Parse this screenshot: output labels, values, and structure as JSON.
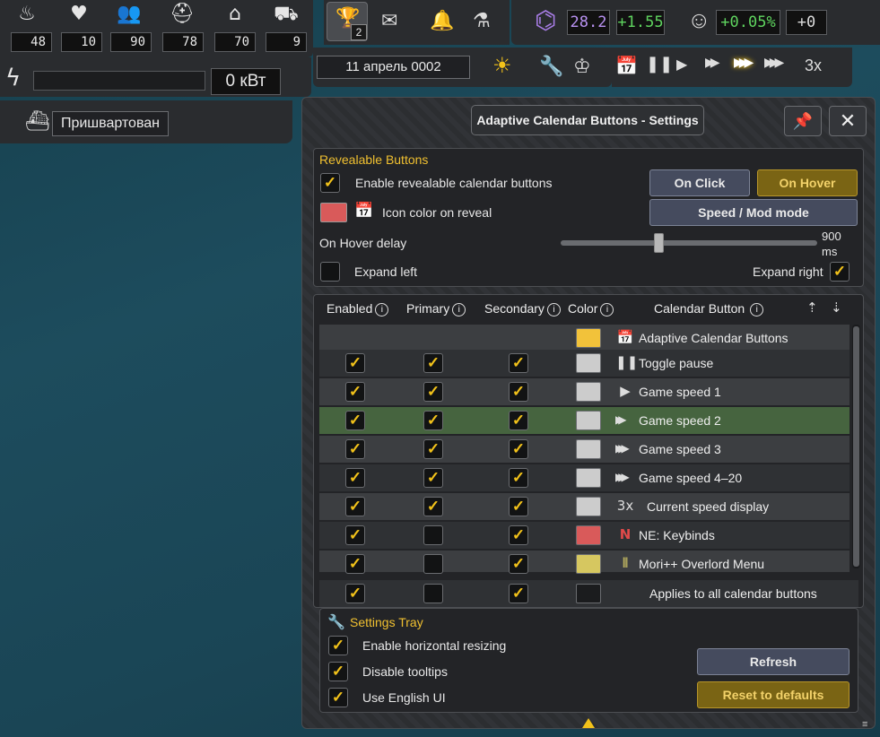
{
  "stats": {
    "icons": [
      "food-icon",
      "health-icon",
      "population-icon",
      "workers-icon",
      "housing-icon",
      "sleep-icon"
    ],
    "values": [
      "48",
      "10",
      "90",
      "78",
      "70",
      "9"
    ]
  },
  "power": {
    "value": "0 кВт"
  },
  "ship": {
    "status": "Пришвартован"
  },
  "top": {
    "trophy_count": "2",
    "research_value": "28.2",
    "research_delta": "+1.55",
    "approval_delta": "+0.05%",
    "approval_extra": "+0"
  },
  "date": {
    "label": "11 апрель 0002"
  },
  "speed": {
    "current": "3x"
  },
  "window": {
    "title": "Adaptive Calendar Buttons - Settings"
  },
  "revealable": {
    "title": "Revealable Buttons",
    "enable_label": "Enable revealable calendar buttons",
    "enable_checked": "✓",
    "icon_color_label": "Icon color on reveal",
    "on_click_label": "On Click",
    "on_hover_label": "On Hover",
    "speed_mod_label": "Speed / Mod mode",
    "hover_delay_label": "On Hover delay",
    "hover_delay_value": "900",
    "hover_delay_unit": "ms",
    "hover_delay_fraction": 0.38,
    "expand_left_label": "Expand left",
    "expand_right_label": "Expand right",
    "expand_right_checked": "✓",
    "icon_color": "#d95a5a"
  },
  "table": {
    "headers": {
      "enabled": "Enabled",
      "primary": "Primary",
      "secondary": "Secondary",
      "color": "Color",
      "calendar_button": "Calendar Button"
    },
    "rows": [
      {
        "name": "Adaptive Calendar Buttons",
        "enabled": "",
        "primary": "",
        "secondary": "",
        "color": "#f2c23a",
        "icon": "calendar-icon",
        "glyph": "📅"
      },
      {
        "name": "Toggle pause",
        "enabled": "✓",
        "primary": "✓",
        "secondary": "✓",
        "color": "#cccccc",
        "icon": "pause-icon",
        "glyph": "❚❚"
      },
      {
        "name": "Game speed 1",
        "enabled": "✓",
        "primary": "✓",
        "secondary": "✓",
        "color": "#cccccc",
        "icon": "play-icon",
        "glyph": "▶"
      },
      {
        "name": "Game speed 2",
        "enabled": "✓",
        "primary": "✓",
        "secondary": "✓",
        "color": "#cccccc",
        "icon": "fast-forward-icon",
        "glyph": "▶▶"
      },
      {
        "name": "Game speed 3",
        "enabled": "✓",
        "primary": "✓",
        "secondary": "✓",
        "color": "#cccccc",
        "icon": "faster-forward-icon",
        "glyph": "▶▶▶"
      },
      {
        "name": "Game speed 4–20",
        "enabled": "✓",
        "primary": "✓",
        "secondary": "✓",
        "color": "#cccccc",
        "icon": "fastest-forward-icon",
        "glyph": "▶▶▶"
      },
      {
        "name": "Current speed display",
        "enabled": "✓",
        "primary": "✓",
        "secondary": "✓",
        "color": "#cccccc",
        "icon": "speed-text-icon",
        "glyph": "3x"
      },
      {
        "name": "NE: Keybinds",
        "enabled": "✓",
        "primary": "",
        "secondary": "✓",
        "color": "#d95a5a",
        "icon": "ne-logo-icon",
        "glyph": "N"
      },
      {
        "name": "Mori++ Overlord Menu",
        "enabled": "✓",
        "primary": "",
        "secondary": "✓",
        "color": "#d6c760",
        "icon": "mori-logo-icon",
        "glyph": "⦀"
      }
    ],
    "all_row": {
      "label": "Applies to all calendar buttons",
      "enabled": "✓",
      "primary": "",
      "secondary": "✓"
    }
  },
  "tray": {
    "title": "Settings Tray",
    "resize_label": "Enable horizontal resizing",
    "tooltips_label": "Disable tooltips",
    "english_label": "Use English UI",
    "check": "✓",
    "refresh_label": "Refresh",
    "reset_label": "Reset to defaults"
  },
  "colors": {
    "accent": "#f2c21a",
    "highlight_row": "#46643f"
  }
}
